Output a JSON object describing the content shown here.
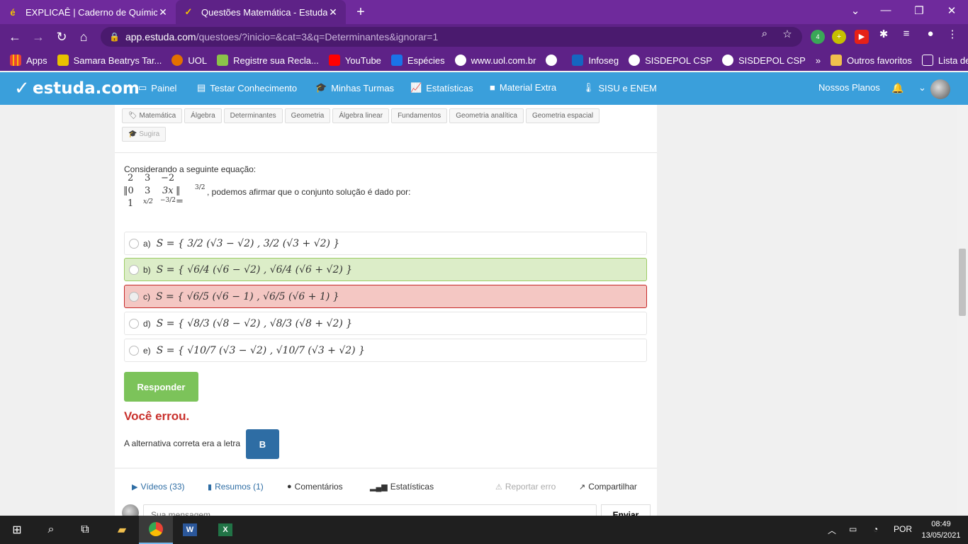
{
  "browser": {
    "tabs": [
      {
        "title": "EXPLICAÊ | Caderno de Química",
        "icon": "explicae-icon"
      },
      {
        "title": "Questões Matemática - Estuda.co",
        "icon": "estuda-icon"
      }
    ],
    "url_host": "app.estuda.com",
    "url_path": "/questoes/?inicio=&cat=3&q=Determinantes&ignorar=1",
    "ext_badge": "4",
    "bookmarks": [
      "Apps",
      "Samara Beatrys Tar...",
      "UOL",
      "Registre sua Recla...",
      "YouTube",
      "Espécies",
      "www.uol.com.br",
      "",
      "Infoseg",
      "SISDEPOL CSP",
      "SISDEPOL CSP"
    ],
    "bookmarks_more": "»",
    "other_favorites": "Outros favoritos",
    "reading_list": "Lista de leitura"
  },
  "site": {
    "logo": "estuda.com",
    "nav": [
      "Painel",
      "Testar Conhecimento",
      "Minhas Turmas",
      "Estatísticas",
      "Material Extra",
      "SISU e ENEM"
    ],
    "plans": "Nossos Planos"
  },
  "question": {
    "tags": [
      "Matemática",
      "Álgebra",
      "Determinantes",
      "Geometria",
      "Álgebra linear",
      "Fundamentos",
      "Geometria analítica",
      "Geometria espacial"
    ],
    "tag_suggest": "Sugira",
    "prompt": "Considerando a seguinte equação:",
    "matrix": {
      "r1": [
        "2",
        "3",
        "−2"
      ],
      "r2": [
        "‖0",
        "3",
        "3x",
        "‖ ="
      ],
      "r3": [
        "1"
      ],
      "frac_x": "x/2",
      "frac_m3": "−3/2",
      "rhs": "3/2"
    },
    "after_text": ", podemos afirmar que o conjunto solução é dado por:",
    "options": [
      {
        "letter": "a)",
        "expr": "S = { 3/2 (√3 − √2) , 3/2 (√3 + √2) }",
        "state": "none"
      },
      {
        "letter": "b)",
        "expr": "S = { √6/4 (√6 − √2) , √6/4 (√6 + √2) }",
        "state": "correct"
      },
      {
        "letter": "c)",
        "expr": "S = { √6/5 (√6 − 1) , √6/5 (√6 + 1) }",
        "state": "wrong"
      },
      {
        "letter": "d)",
        "expr": "S = { √8/3 (√8 − √2) , √8/3 (√8 + √2) }",
        "state": "none"
      },
      {
        "letter": "e)",
        "expr": "S = { √10/7 (√3 − √2) , √10/7 (√3 + √2) }",
        "state": "none"
      }
    ],
    "respond_label": "Responder",
    "result": "Você errou.",
    "correct_text": "A alternativa correta era a letra",
    "correct_letter": "B"
  },
  "footer": {
    "videos": "Vídeos (33)",
    "resumos": "Resumos (1)",
    "comentarios": "Comentários",
    "estatisticas": "Estatísticas",
    "reportar": "Reportar erro",
    "compartilhar": "Compartilhar",
    "msg_placeholder": "Sua mensagem...",
    "send": "Enviar"
  },
  "taskbar": {
    "lang": "POR",
    "time": "08:49",
    "date": "13/05/2021"
  },
  "colors": {
    "browser": "#5e2287",
    "site_nav": "#3a9fdb",
    "correct": "#dcedc8",
    "wrong": "#f4c7c3",
    "respond": "#7cc35a",
    "badge": "#2e6da4"
  }
}
